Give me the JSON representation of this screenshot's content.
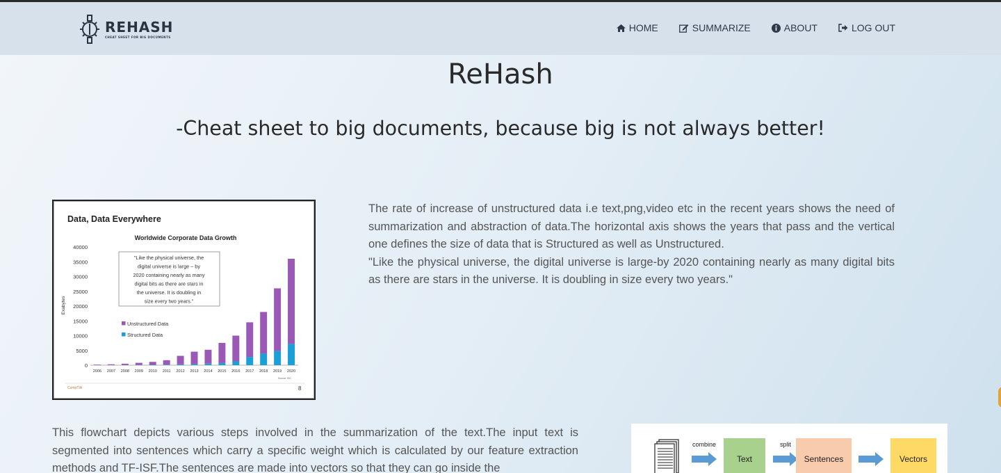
{
  "brand": {
    "name": "REHASH",
    "tagline": "CHEAT SHEET FOR BIG DOCUMENTS",
    "icon": "gear-wrench-logo-icon"
  },
  "nav": {
    "items": [
      {
        "label": "HOME",
        "icon": "home-icon"
      },
      {
        "label": "SUMMARIZE",
        "icon": "edit-icon"
      },
      {
        "label": "ABOUT",
        "icon": "info-icon"
      },
      {
        "label": "LOG OUT",
        "icon": "logout-icon"
      }
    ]
  },
  "hero": {
    "title": "ReHash",
    "subtitle": "-Cheat sheet to big documents, because big is not always better!"
  },
  "section1": {
    "paragraph_1": "The rate of increase of unstructured data i.e text,png,video etc in the recent years shows the need of summarization and abstraction of data.The horizontal axis shows the years that pass and the vertical one defines the size of data that is Structured as well as Unstructured.",
    "paragraph_2": "\"Like the physical universe, the digital universe is large-by 2020 containing nearly as many digital bits as there are stars in the universe. It is doubling in size every two years.\""
  },
  "section2": {
    "paragraph": "This flowchart depicts various steps involved in the summarization of the text.The input text is segmented into sentences which carry a specific weight which is calculated by our feature extraction methods and TF-ISF.The sentences are made into vectors so that they can go inside the"
  },
  "flowchart": {
    "steps": [
      {
        "label": "Text",
        "color": "#a9d18e"
      },
      {
        "label": "Sentences",
        "color": "#f8cbad"
      },
      {
        "label": "Vectors",
        "color": "#ffd966"
      }
    ],
    "arrows": [
      "combine",
      "split",
      ""
    ]
  },
  "chart_data": {
    "type": "bar",
    "slide_title": "Data, Data Everywhere",
    "title": "Worldwide Corporate Data Growth",
    "ylabel": "Exabytes",
    "xlabel": "",
    "ylim": [
      0,
      40000
    ],
    "yticks": [
      0,
      5000,
      10000,
      15000,
      20000,
      25000,
      30000,
      35000,
      40000
    ],
    "categories": [
      "2006",
      "2007",
      "2008",
      "2009",
      "2010",
      "2011",
      "2012",
      "2013",
      "2014",
      "2015",
      "2016",
      "2017",
      "2018",
      "2019",
      "2020"
    ],
    "stacked": true,
    "series": [
      {
        "name": "Structured Data",
        "color": "#1aa0d6",
        "values": [
          20,
          30,
          50,
          80,
          120,
          180,
          260,
          370,
          520,
          730,
          1300,
          2800,
          3900,
          4800,
          7200
        ]
      },
      {
        "name": "Unstructured Data",
        "color": "#9b59b6",
        "values": [
          180,
          270,
          450,
          720,
          1000,
          1500,
          2900,
          4200,
          4700,
          6800,
          8700,
          11700,
          14100,
          21200,
          28800
        ]
      }
    ],
    "annotation": "\"Like the physical universe, the digital universe is large – by 2020 containing nearly as many digital bits as there are stars in the universe. It is doubling in size every two years.\"",
    "source": "Source: IDC",
    "footer_left": "CompTIA",
    "page_number": "8"
  }
}
